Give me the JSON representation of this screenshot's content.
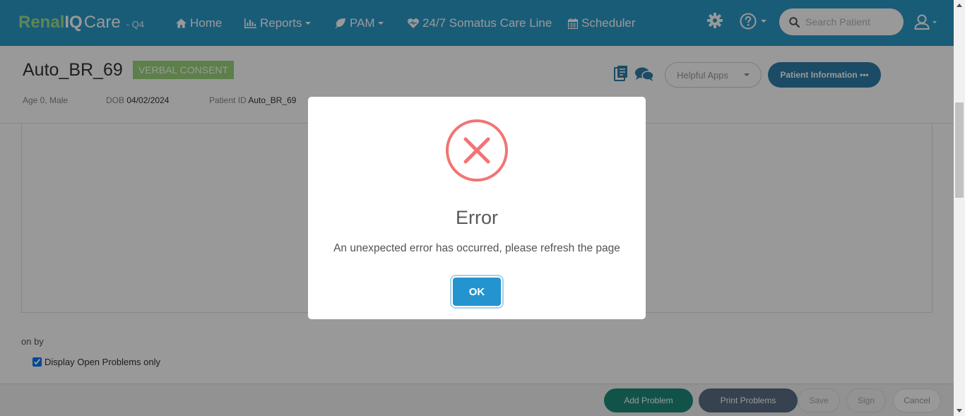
{
  "navbar": {
    "brand_part1": "Renal",
    "brand_part2": "IQ",
    "brand_part3": "Care",
    "environment": "- Q4",
    "items": [
      {
        "label": "Home",
        "icon": "home-icon"
      },
      {
        "label": "Reports",
        "icon": "bar-chart-icon"
      },
      {
        "label": "PAM",
        "icon": "leaf-icon"
      },
      {
        "label": "24/7 Somatus Care Line",
        "icon": "heart-icon"
      },
      {
        "label": "Scheduler",
        "icon": "calendar-icon"
      }
    ],
    "search_placeholder": "Search Patient"
  },
  "patient": {
    "name": "Auto_BR_69",
    "consent_badge": "VERBAL CONSENT",
    "age_gender": "Age 0, Male",
    "dob_label": "DOB",
    "dob_value": "04/02/2024",
    "patient_id_label": "Patient ID",
    "patient_id_value": "Auto_BR_69",
    "helpful_apps": "Helpful Apps",
    "patient_info_button": "Patient Information •••"
  },
  "content": {
    "sort_label": "on by",
    "checkbox_label": "Display Open Problems only",
    "checkbox_checked": true
  },
  "footer": {
    "buttons": [
      "Add Problem",
      "Print Problems",
      "Save",
      "Sign",
      "Cancel"
    ]
  },
  "modal": {
    "title": "Error",
    "message": "An unexpected error has occurred, please refresh the page",
    "ok_label": "OK",
    "icon": "error-x-icon",
    "icon_color": "#f27474",
    "button_color": "#2394cf"
  }
}
